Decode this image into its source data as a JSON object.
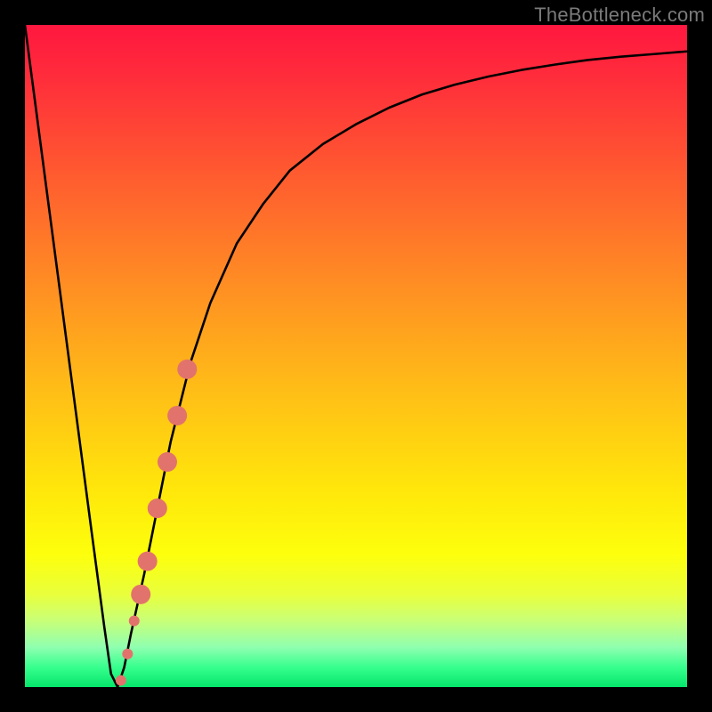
{
  "watermark": "TheBottleneck.com",
  "colors": {
    "frame": "#000000",
    "curve": "#000000",
    "marker": "#e2736c"
  },
  "chart_data": {
    "type": "line",
    "title": "",
    "xlabel": "",
    "ylabel": "",
    "xlim": [
      0,
      100
    ],
    "ylim": [
      0,
      100
    ],
    "series": [
      {
        "name": "bottleneck-curve",
        "x": [
          0,
          5,
          10,
          12,
          13,
          14,
          15,
          16,
          18,
          20,
          22,
          25,
          28,
          32,
          36,
          40,
          45,
          50,
          55,
          60,
          65,
          70,
          75,
          80,
          85,
          90,
          95,
          100
        ],
        "values": [
          100,
          62,
          24,
          9,
          2,
          0,
          3,
          8,
          17,
          27,
          37,
          49,
          58,
          67,
          73,
          78,
          82,
          85,
          87.5,
          89.5,
          91,
          92.2,
          93.2,
          94,
          94.7,
          95.2,
          95.6,
          96
        ]
      }
    ],
    "markers": {
      "name": "highlighted-range",
      "x": [
        14.5,
        15.5,
        16.5,
        17.5,
        18.5,
        20,
        21.5,
        23,
        24.5
      ],
      "values": [
        1,
        5,
        10,
        14,
        19,
        27,
        34,
        41,
        48
      ]
    }
  }
}
